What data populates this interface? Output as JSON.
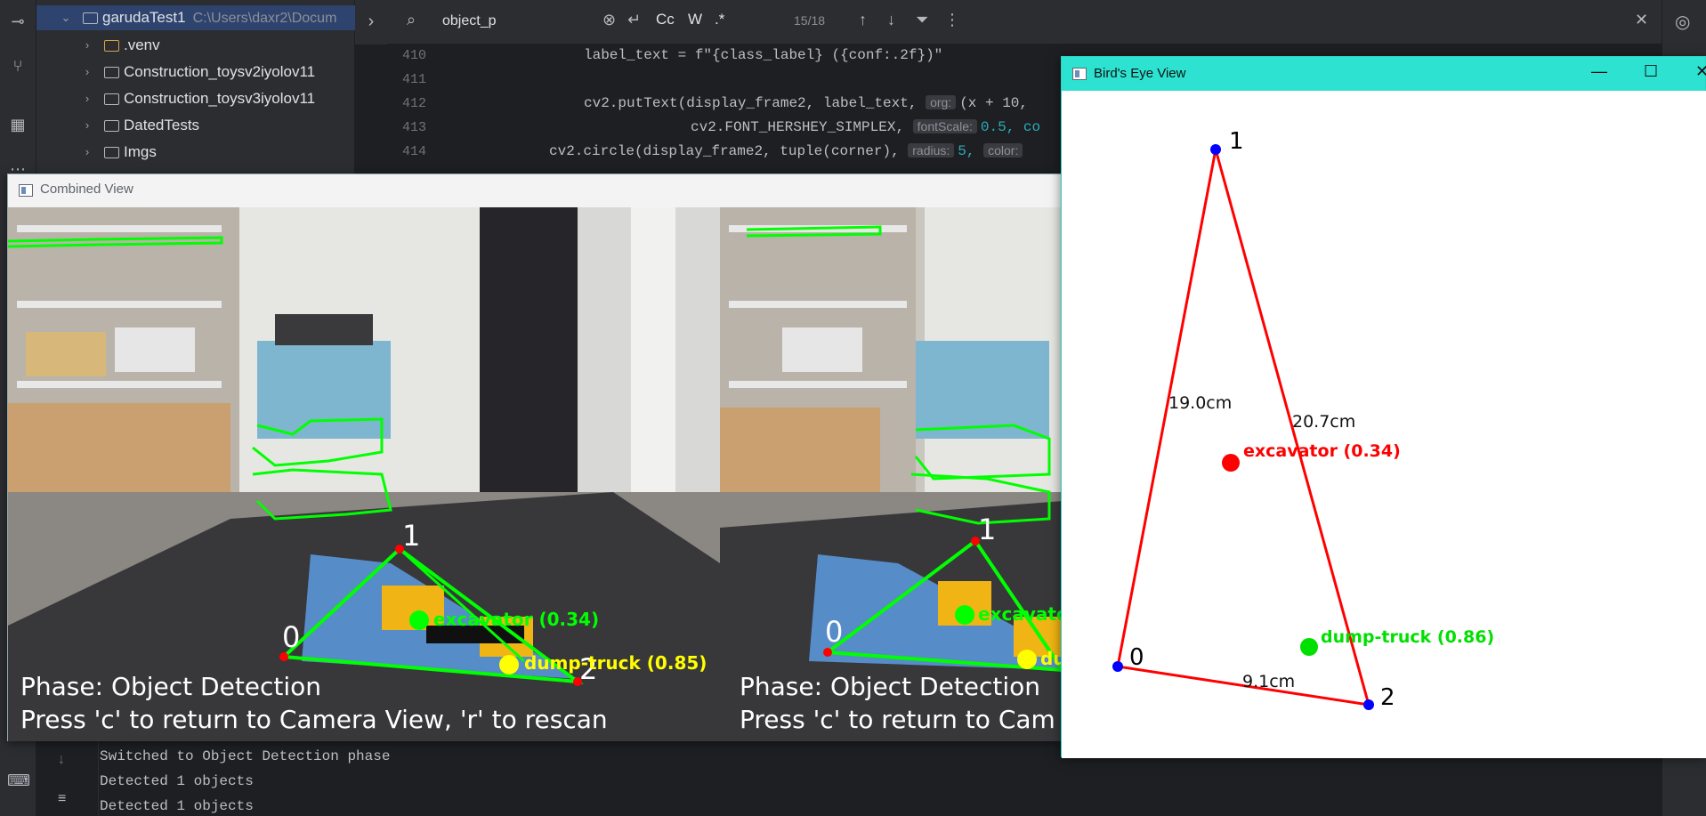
{
  "project_tree": {
    "root": {
      "name": "garudaTest1",
      "path": "C:\\Users\\daxr2\\Docum"
    },
    "items": [
      {
        "name": ".venv"
      },
      {
        "name": "Construction_toysv2iyolov11"
      },
      {
        "name": "Construction_toysv3iyolov11"
      },
      {
        "name": "DatedTests"
      },
      {
        "name": "Imgs"
      }
    ]
  },
  "find_bar": {
    "query": "object_p",
    "match_case": "Cc",
    "words": "W",
    "regex": ".*",
    "match_count": "15/18"
  },
  "editor": {
    "lines": [
      {
        "num": "410"
      },
      {
        "num": "411"
      },
      {
        "num": "412"
      },
      {
        "num": "413"
      },
      {
        "num": "414"
      }
    ],
    "hints": {
      "org": "org:",
      "fontScale": "fontScale:",
      "radius": "radius:",
      "color": "color:"
    },
    "code": {
      "l410": "label_text = f\"{class_label} ({conf:.2f})\"",
      "l412_pre": "cv2.putText(display_frame2, label_text, ",
      "l412_post": "(x + 10,",
      "l413_pre": "cv2.FONT_HERSHEY_SIMPLEX, ",
      "l413_post": "0.5, co",
      "l414_pre": "cv2.circle(display_frame2, tuple(corner), ",
      "l414_mid": "5, "
    }
  },
  "console": {
    "lines": [
      "Switched to Object Detection phase",
      "Detected 1 objects",
      "Detected 1 objects"
    ]
  },
  "combined_view": {
    "title": "Combined View",
    "left": {
      "phase": "Phase: Object Detection",
      "instructions": "Press 'c' to return to Camera View, 'r' to rescan",
      "corners": [
        "0",
        "1",
        "2"
      ],
      "detections": [
        {
          "label": "excavator (0.34)",
          "color": "#00ff00"
        },
        {
          "label": "dump-truck (0.85)",
          "color": "#ffff00"
        }
      ]
    },
    "right": {
      "phase": "Phase: Object Detection",
      "instructions": "Press 'c' to return to Cam",
      "corners": [
        "0",
        "1"
      ],
      "detections": [
        {
          "label": "excavato",
          "color": "#00ff00"
        },
        {
          "label": "dum",
          "color": "#ffff00"
        }
      ]
    }
  },
  "birds_eye_view": {
    "title": "Bird's Eye View",
    "corners": [
      "0",
      "1",
      "2"
    ],
    "distances": [
      "19.0cm",
      "20.7cm",
      "9.1cm"
    ],
    "objects": [
      {
        "label": "excavator (0.34)",
        "color": "#ff0000"
      },
      {
        "label": "dump-truck (0.86)",
        "color": "#00e000"
      }
    ]
  },
  "colors": {
    "ide_bg": "#1e1f22",
    "ide_panel": "#2b2d30",
    "birdseye_title": "#2de2d0",
    "triangle": "#ff0000",
    "corner_dot": "#0000ff"
  }
}
